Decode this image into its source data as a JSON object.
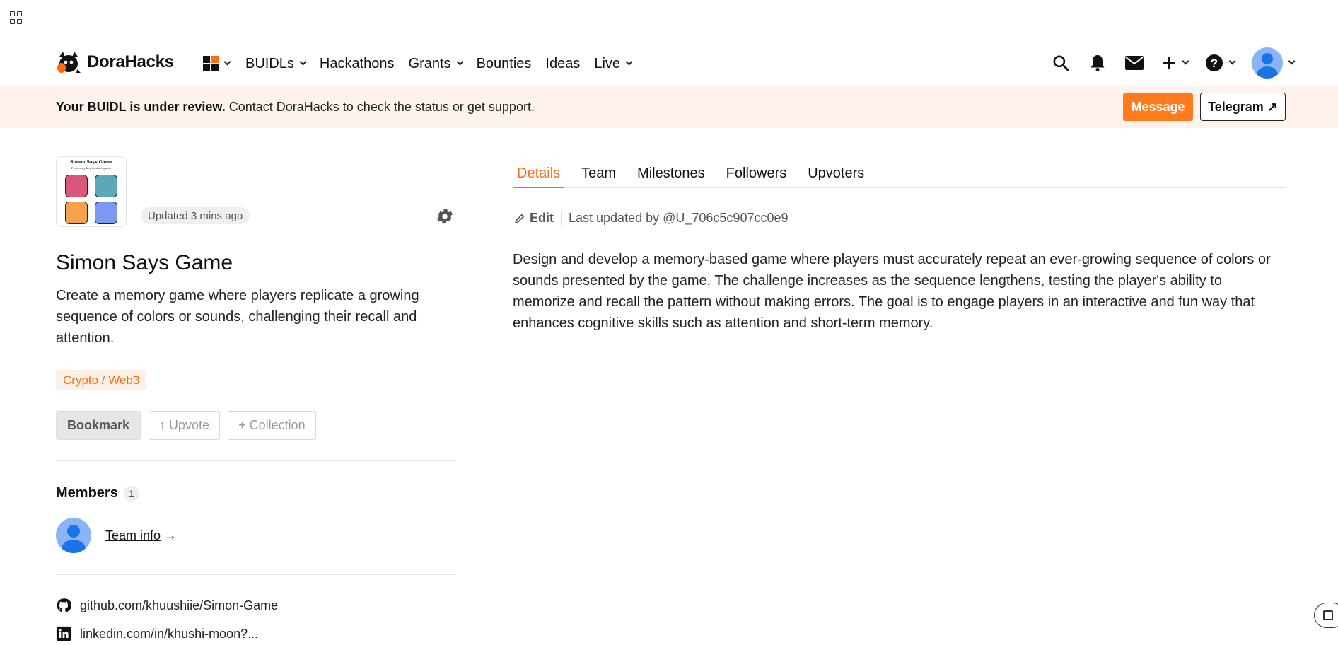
{
  "nav": {
    "brand": "DoraHacks",
    "items": [
      "BUIDLs",
      "Hackathons",
      "Grants",
      "Bounties",
      "Ideas",
      "Live"
    ],
    "accent": "#ff6b10"
  },
  "banner": {
    "bold_text": "Your BUIDL is under review.",
    "text": " Contact DoraHacks to check the status or get support.",
    "message_label": "Message",
    "telegram_label": "Telegram ↗"
  },
  "project": {
    "thumb_title": "Simon Says Game",
    "thumb_sub": "Press any key to start game",
    "updated": "Updated 3 mins ago",
    "title": "Simon Says Game",
    "description": "Create a memory game where players replicate a growing sequence of colors or sounds, challenging their recall and attention.",
    "tag": "Crypto / Web3",
    "bookmark_label": "Bookmark",
    "upvote_label": "↑ Upvote",
    "collection_label": "+ Collection"
  },
  "members": {
    "label": "Members",
    "count": "1",
    "team_info": "Team info",
    "arrow": " →"
  },
  "links": {
    "github": "github.com/khuushiie/Simon-Game",
    "linkedin": "linkedin.com/in/khushi-moon?..."
  },
  "tabs": [
    "Details",
    "Team",
    "Milestones",
    "Followers",
    "Upvoters"
  ],
  "details": {
    "edit_label": "Edit",
    "last_updated": "Last updated by @U_706c5c907cc0e9",
    "body": "Design and develop a memory-based game where players must accurately repeat an ever-growing sequence of colors or sounds presented by the game. The challenge increases as the sequence lengthens, testing the player's ability to memorize and recall the pattern without making errors. The goal is to engage players in an interactive and fun way that enhances cognitive skills such as attention and short-term memory."
  }
}
